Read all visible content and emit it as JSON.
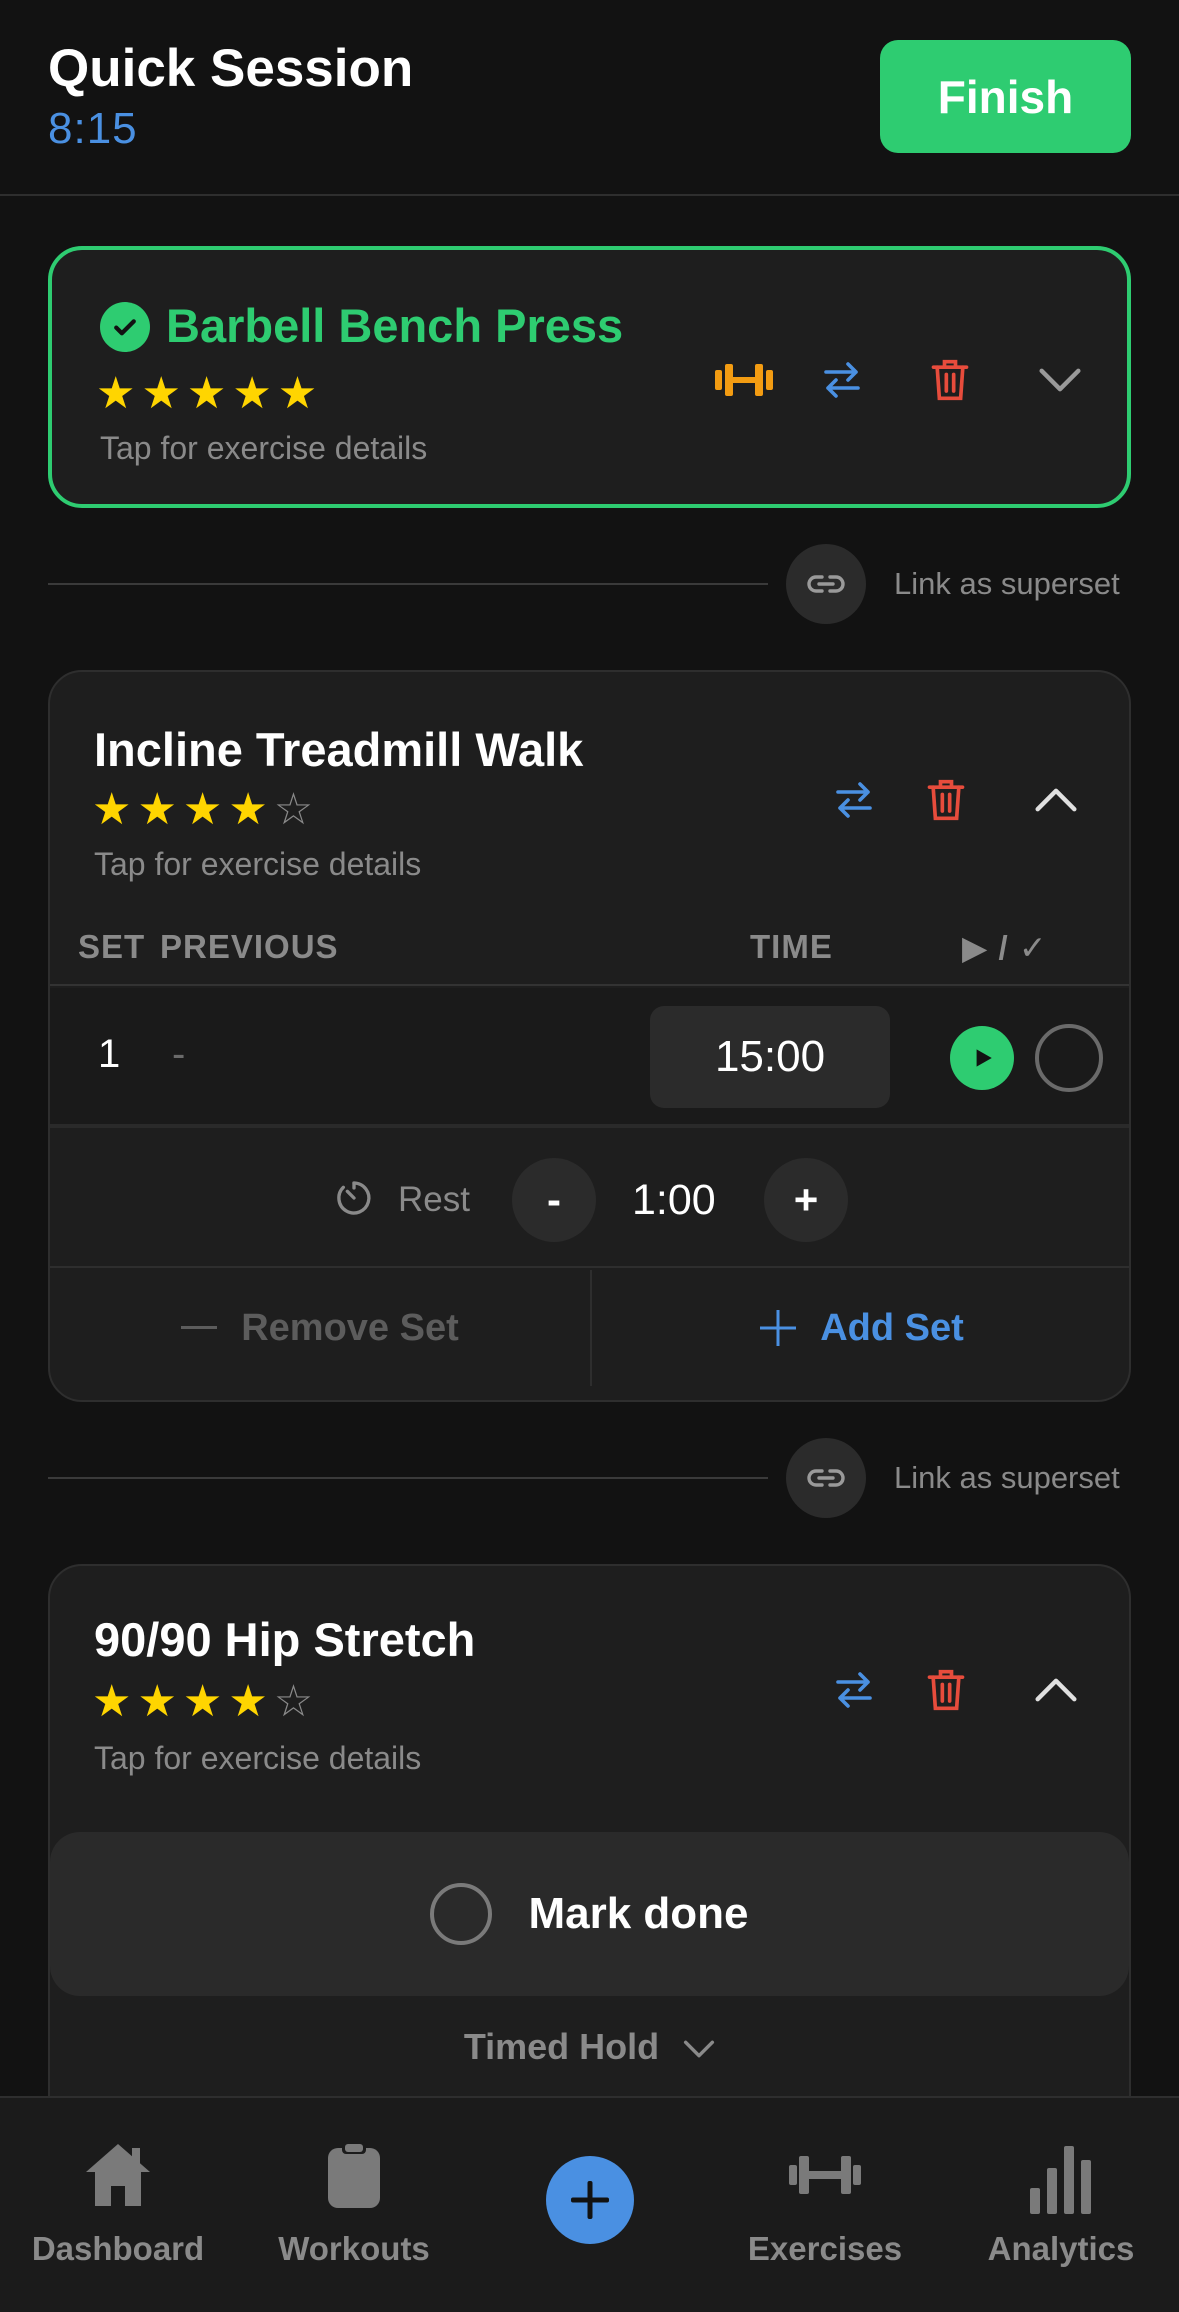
{
  "header": {
    "title": "Quick Session",
    "timer": "8:15",
    "finish_label": "Finish"
  },
  "exercises": [
    {
      "name": "Barbell Bench Press",
      "stars": "★★★★★",
      "stars_off": "",
      "hint": "Tap for exercise details",
      "done": true
    },
    {
      "name": "Incline Treadmill Walk",
      "stars": "★★★★",
      "stars_off": "☆",
      "hint": "Tap for exercise details"
    },
    {
      "name": "90/90 Hip Stretch",
      "stars": "★★★★",
      "stars_off": "☆",
      "hint": "Tap for exercise details"
    }
  ],
  "superset_label": "Link as superset",
  "sets_table": {
    "col_set": "SET",
    "col_previous": "PREVIOUS",
    "col_time": "TIME",
    "col_action": "▶ / ✓",
    "rows": [
      {
        "set": "1",
        "previous": "-",
        "time": "15:00"
      }
    ],
    "rest_label": "Rest",
    "rest_minus": "-",
    "rest_value": "1:00",
    "rest_plus": "+",
    "remove_set": "Remove Set",
    "add_set": "Add Set"
  },
  "stretch": {
    "mark_done": "Mark done",
    "mode": "Timed Hold"
  },
  "tabs": {
    "dashboard": "Dashboard",
    "workouts": "Workouts",
    "exercises": "Exercises",
    "analytics": "Analytics"
  },
  "colors": {
    "accent_green": "#2ecc71",
    "accent_blue": "#4a90e2",
    "danger": "#e74c3c",
    "star": "#ffd500",
    "equipment": "#f39c12"
  }
}
